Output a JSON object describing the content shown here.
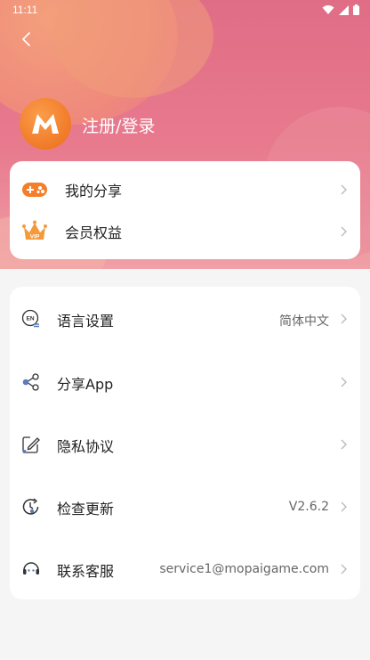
{
  "status_bar": {
    "time": "11:11"
  },
  "profile": {
    "login_label": "注册/登录"
  },
  "quick_links": [
    {
      "label": "我的分享",
      "icon": "gamepad-share-icon"
    },
    {
      "label": "会员权益",
      "icon": "vip-crown-icon"
    }
  ],
  "settings": [
    {
      "label": "语言设置",
      "value": "简体中文",
      "icon": "language-icon"
    },
    {
      "label": "分享App",
      "value": "",
      "icon": "share-icon"
    },
    {
      "label": "隐私协议",
      "value": "",
      "icon": "privacy-edit-icon"
    },
    {
      "label": "检查更新",
      "value": "V2.6.2",
      "icon": "update-icon"
    },
    {
      "label": "联系客服",
      "value": "service1@mopaigame.com",
      "icon": "customer-service-icon"
    }
  ],
  "colors": {
    "accent": "#f27a2b",
    "header_pink": "#e06d86"
  }
}
